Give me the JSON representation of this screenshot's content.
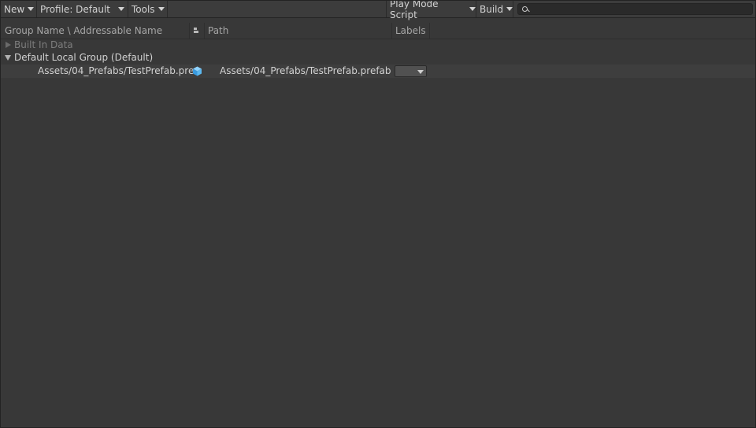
{
  "toolbar": {
    "new_label": "New",
    "profile_label": "Profile: Default",
    "tools_label": "Tools",
    "play_mode_label": "Play Mode Script",
    "build_label": "Build",
    "search_value": ""
  },
  "columns": {
    "name": "Group Name \\ Addressable Name",
    "path": "Path",
    "labels": "Labels"
  },
  "groups": [
    {
      "name": "Built In Data",
      "expanded": false
    },
    {
      "name": "Default Local Group (Default)",
      "expanded": true,
      "entries": [
        {
          "address": "Assets/04_Prefabs/TestPrefab.pre",
          "icon": "prefab-cube-icon",
          "path": "Assets/04_Prefabs/TestPrefab.prefab",
          "labels": ""
        }
      ]
    }
  ],
  "colors": {
    "background": "#383838",
    "toolbar": "#3c3c3c",
    "prefab_icon": "#5cb8f0"
  }
}
